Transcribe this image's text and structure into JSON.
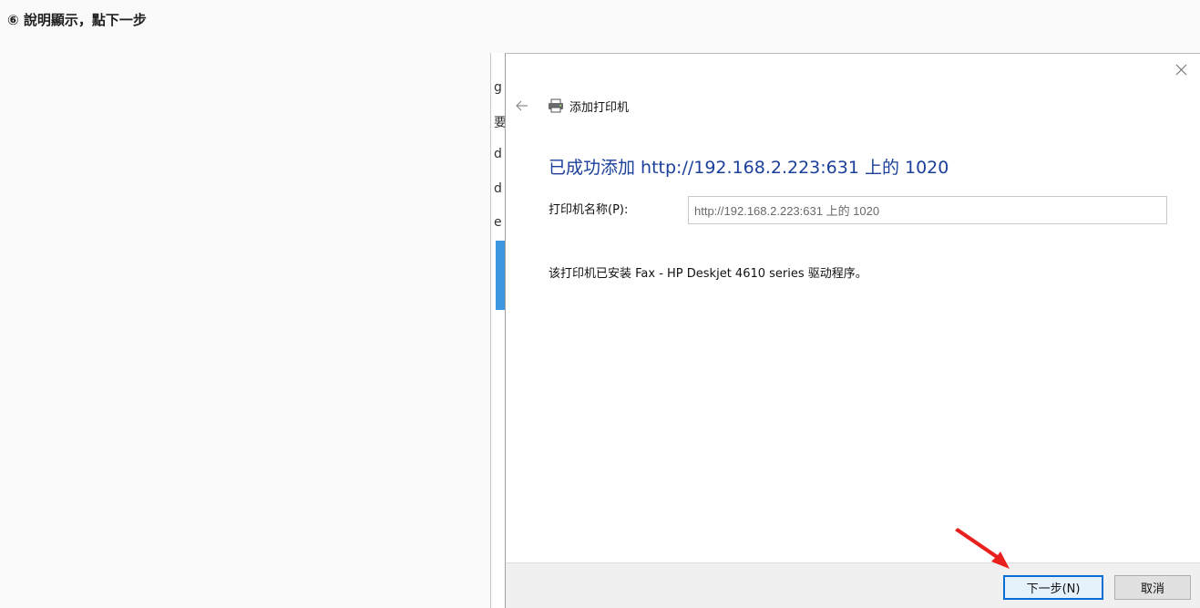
{
  "caption": "⑥ 說明顯示，點下一步",
  "background_window": {
    "fragments": [
      "g",
      "要",
      "d",
      "d",
      "e"
    ]
  },
  "dialog": {
    "close_glyph": "×",
    "back_glyph": "←",
    "title": "添加打印机",
    "heading": "已成功添加 http://192.168.2.223:631 上的 1020",
    "printer_name_label": "打印机名称(P):",
    "printer_name_value": "http://192.168.2.223:631 上的 1020",
    "driver_message": "该打印机已安装 Fax - HP Deskjet 4610 series 驱动程序。",
    "next_button": "下一步(N)",
    "cancel_button": "取消"
  },
  "colors": {
    "heading": "#1b3f9a",
    "primary_button_border": "#0a6cd6",
    "annotation_arrow": "#e8211e",
    "selection_strip": "#3c96e0"
  }
}
